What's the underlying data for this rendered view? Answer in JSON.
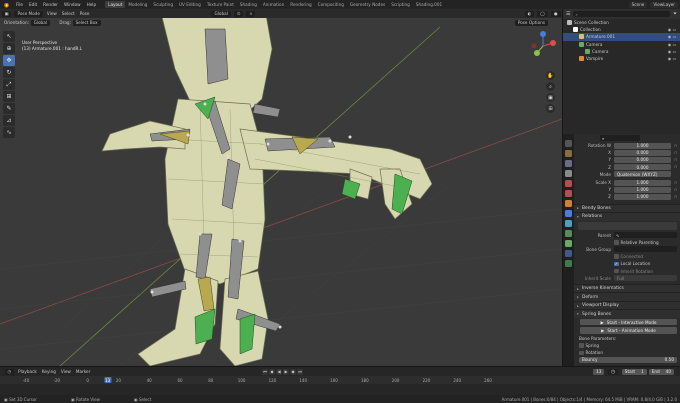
{
  "topbar": {
    "menus": [
      "File",
      "Edit",
      "Render",
      "Window",
      "Help"
    ],
    "workspaces": [
      "Layout",
      "Modeling",
      "Sculpting",
      "UV Editing",
      "Texture Paint",
      "Shading",
      "Animation",
      "Rendering",
      "Compositing",
      "Geometry Nodes",
      "Scripting",
      "Shading.001"
    ],
    "active_workspace": "Layout",
    "scene": "Scene",
    "view_layer": "ViewLayer"
  },
  "viewport": {
    "mode": "Pose Mode",
    "menus": [
      "View",
      "Select",
      "Pose"
    ],
    "transform": "Global",
    "orientation_label": "Orientation:",
    "orientation": "Global",
    "drag_label": "Drag:",
    "drag": "Select Box",
    "pose_options": "Pose Options",
    "info_line1": "User Perspective",
    "info_line2": "(13) Armature.001 : handR.L"
  },
  "outliner": {
    "rows": [
      {
        "label": "Scene Collection",
        "indent": 0,
        "icon_color": "#bbbbbb",
        "selected": false
      },
      {
        "label": "Collection",
        "indent": 1,
        "icon_color": "#ffffff",
        "selected": false
      },
      {
        "label": "Armature.001",
        "indent": 2,
        "icon_color": "#d8c07a",
        "selected": true
      },
      {
        "label": "Camera",
        "indent": 2,
        "icon_color": "#6aa86a",
        "selected": false
      },
      {
        "label": "Camera",
        "indent": 3,
        "icon_color": "#6aa86a",
        "selected": false
      },
      {
        "label": "Vampire",
        "indent": 2,
        "icon_color": "#e08a3c",
        "selected": false
      }
    ]
  },
  "properties": {
    "rotation": [
      {
        "label": "Rotation W",
        "value": "1.000"
      },
      {
        "label": "X",
        "value": "0.000"
      },
      {
        "label": "Y",
        "value": "0.000"
      },
      {
        "label": "Z",
        "value": "0.000"
      }
    ],
    "mode_label": "Mode",
    "mode_value": "Quaternion (WXYZ)",
    "scale": [
      {
        "label": "Scale X",
        "value": "1.000"
      },
      {
        "label": "Y",
        "value": "1.000"
      },
      {
        "label": "Z",
        "value": "1.000"
      }
    ],
    "bendy_bones": "Bendy Bones",
    "relations": "Relations",
    "parent_label": "Parent",
    "relative_parenting": "Relative Parenting",
    "bone_group_label": "Bone Group",
    "connected": "Connected",
    "local_location": "Local Location",
    "inherit_rotation": "Inherit Rotation",
    "inherit_scale_label": "Inherit Scale",
    "inherit_scale_value": "Full",
    "panels": [
      "Inverse Kinematics",
      "Deform",
      "Viewport Display",
      "Spring Bones"
    ],
    "btn_interactive": "Start - Interactive Mode",
    "btn_animation": "Start - Animation Mode",
    "bone_params": "Bone Parameters:",
    "spring": "Spring",
    "rotation_chk": "Rotation",
    "bouncy_label": "Bouncy",
    "bouncy_value": "0.50"
  },
  "timeline": {
    "menus": [
      "Playback",
      "Keying",
      "View",
      "Marker"
    ],
    "ticks": [
      -40,
      -20,
      0,
      20,
      40,
      60,
      80,
      100,
      120,
      140,
      160,
      180,
      200,
      220,
      240,
      260
    ],
    "current_frame": "13",
    "start_label": "Start",
    "start": "1",
    "end_label": "End",
    "end": "40"
  },
  "statusbar": {
    "items": [
      "Set 3D Cursor",
      "Rotate View",
      "Select"
    ],
    "stats": "Armature.001 | Bones:0/84 | Objects:1/4 | Memory: 64.5 MiB | VRAM: 0.8/4.0 GiB | 3.2.0"
  }
}
